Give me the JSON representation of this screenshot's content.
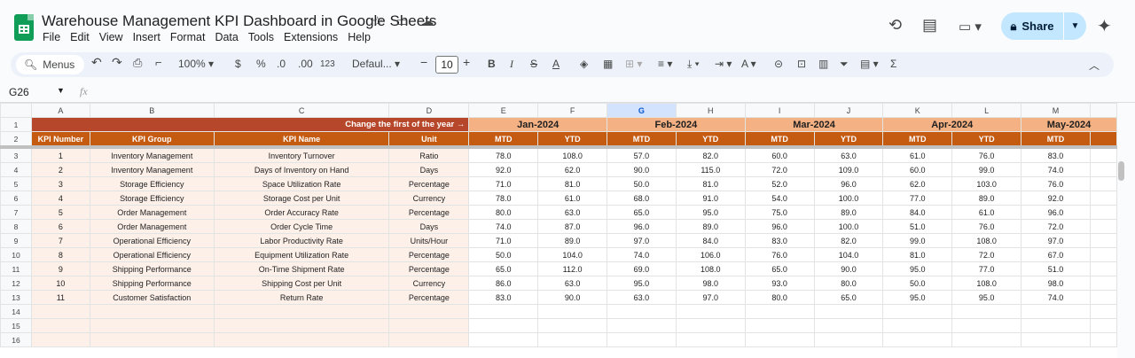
{
  "app": {
    "title": "Warehouse Management KPI Dashboard in Google Sheets",
    "menu": [
      "File",
      "Edit",
      "View",
      "Insert",
      "Format",
      "Data",
      "Tools",
      "Extensions",
      "Help"
    ],
    "share_label": "Share",
    "accent": "#c2e7ff"
  },
  "toolbar": {
    "search_label": "Menus",
    "zoom": "100%",
    "currency": "$",
    "percent": "%",
    "dec_decrease": ".0",
    "dec_increase": ".00",
    "number_format": "123",
    "font": "Defaul...",
    "font_size": "10"
  },
  "formula": {
    "cell_ref": "G26",
    "fx": "fx"
  },
  "sheet": {
    "col_letters": [
      "A",
      "B",
      "C",
      "D",
      "E",
      "F",
      "G",
      "H",
      "I",
      "J",
      "K",
      "L",
      "M",
      ""
    ],
    "selected_col": "G",
    "row1": {
      "note": "Change the first of the year →",
      "months": [
        "Jan-2024",
        "Feb-2024",
        "Mar-2024",
        "Apr-2024",
        "May-2024"
      ]
    },
    "headers": [
      "KPI Number",
      "KPI Group",
      "KPI Name",
      "Unit",
      "MTD",
      "YTD",
      "MTD",
      "YTD",
      "MTD",
      "YTD",
      "MTD",
      "YTD",
      "MTD"
    ],
    "rows": [
      [
        "1",
        "Inventory Management",
        "Inventory Turnover",
        "Ratio",
        "78.0",
        "108.0",
        "57.0",
        "82.0",
        "60.0",
        "63.0",
        "61.0",
        "76.0",
        "83.0"
      ],
      [
        "2",
        "Inventory Management",
        "Days of Inventory on Hand",
        "Days",
        "92.0",
        "62.0",
        "90.0",
        "115.0",
        "72.0",
        "109.0",
        "60.0",
        "99.0",
        "74.0"
      ],
      [
        "3",
        "Storage Efficiency",
        "Space Utilization Rate",
        "Percentage",
        "71.0",
        "81.0",
        "50.0",
        "81.0",
        "52.0",
        "96.0",
        "62.0",
        "103.0",
        "76.0"
      ],
      [
        "4",
        "Storage Efficiency",
        "Storage Cost per Unit",
        "Currency",
        "78.0",
        "61.0",
        "68.0",
        "91.0",
        "54.0",
        "100.0",
        "77.0",
        "89.0",
        "92.0"
      ],
      [
        "5",
        "Order Management",
        "Order Accuracy Rate",
        "Percentage",
        "80.0",
        "63.0",
        "65.0",
        "95.0",
        "75.0",
        "89.0",
        "84.0",
        "61.0",
        "96.0"
      ],
      [
        "6",
        "Order Management",
        "Order Cycle Time",
        "Days",
        "74.0",
        "87.0",
        "96.0",
        "89.0",
        "96.0",
        "100.0",
        "51.0",
        "76.0",
        "72.0"
      ],
      [
        "7",
        "Operational Efficiency",
        "Labor Productivity Rate",
        "Units/Hour",
        "71.0",
        "89.0",
        "97.0",
        "84.0",
        "83.0",
        "82.0",
        "99.0",
        "108.0",
        "97.0"
      ],
      [
        "8",
        "Operational Efficiency",
        "Equipment Utilization Rate",
        "Percentage",
        "50.0",
        "104.0",
        "74.0",
        "106.0",
        "76.0",
        "104.0",
        "81.0",
        "72.0",
        "67.0"
      ],
      [
        "9",
        "Shipping Performance",
        "On-Time Shipment Rate",
        "Percentage",
        "65.0",
        "112.0",
        "69.0",
        "108.0",
        "65.0",
        "90.0",
        "95.0",
        "77.0",
        "51.0"
      ],
      [
        "10",
        "Shipping Performance",
        "Shipping Cost per Unit",
        "Currency",
        "86.0",
        "63.0",
        "95.0",
        "98.0",
        "93.0",
        "80.0",
        "50.0",
        "108.0",
        "98.0"
      ],
      [
        "11",
        "Customer Satisfaction",
        "Return Rate",
        "Percentage",
        "83.0",
        "90.0",
        "63.0",
        "97.0",
        "80.0",
        "65.0",
        "95.0",
        "95.0",
        "74.0"
      ]
    ],
    "empty_rows": [
      "14",
      "15",
      "16"
    ]
  }
}
